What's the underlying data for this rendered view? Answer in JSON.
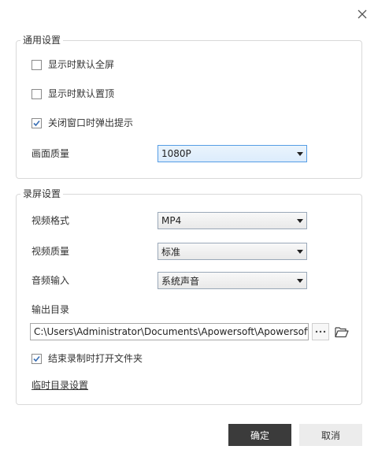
{
  "general": {
    "title": "通用设置",
    "checkboxes": [
      {
        "label": "显示时默认全屏",
        "checked": false
      },
      {
        "label": "显示时默认置顶",
        "checked": false
      },
      {
        "label": "关闭窗口时弹出提示",
        "checked": true
      }
    ],
    "quality_label": "画面质量",
    "quality_value": "1080P"
  },
  "record": {
    "title": "录屏设置",
    "format_label": "视频格式",
    "format_value": "MP4",
    "video_quality_label": "视频质量",
    "video_quality_value": "标准",
    "audio_label": "音频输入",
    "audio_value": "系统声音",
    "output_label": "输出目录",
    "output_path": "C:\\Users\\Administrator\\Documents\\Apowersoft\\Apowersoft iPhon",
    "browse_label": "···",
    "open_folder_checkbox": {
      "label": "结束录制时打开文件夹",
      "checked": true
    },
    "temp_dir_link": "临时目录设置"
  },
  "footer": {
    "ok_label": "确定",
    "cancel_label": "取消"
  },
  "colors": {
    "primary_button": "#3b3b3b",
    "secondary_button": "#ececec",
    "focused_select": "#dcecfc",
    "checkmark": "#3a6fb5"
  },
  "icons": {
    "close": "close-icon",
    "browse": "more-icon",
    "folder": "folder-open-icon",
    "dropdown": "chevron-down-icon",
    "check": "checkmark-icon"
  }
}
